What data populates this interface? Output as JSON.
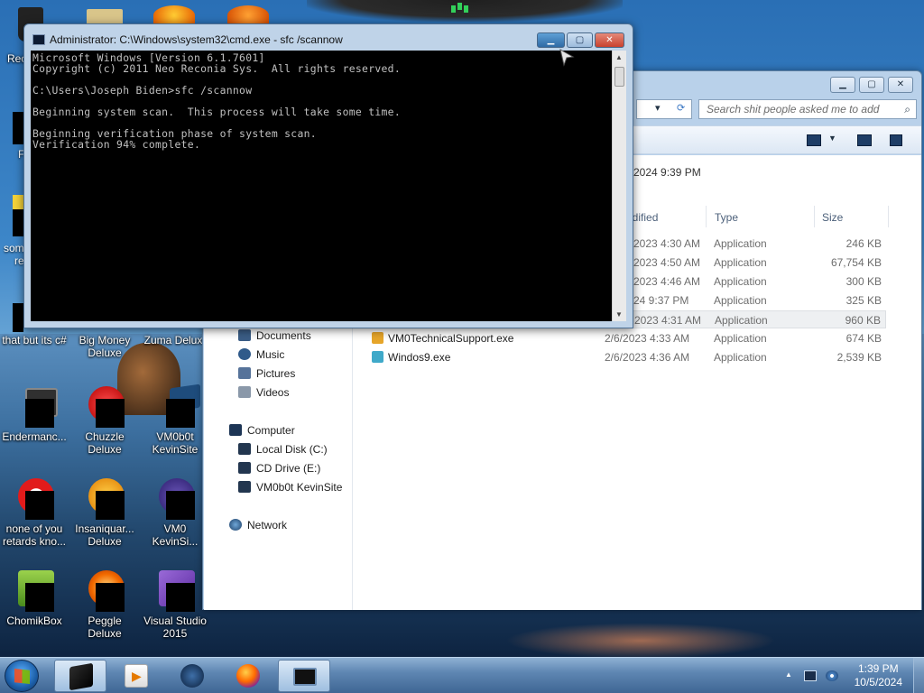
{
  "desktop": {
    "icons": [
      {
        "label": "Rec",
        "pos": "r0c0"
      },
      {
        "label": "that but its c#",
        "pos": "r1c0"
      },
      {
        "label": "Big Money Deluxe",
        "pos": "r1c1"
      },
      {
        "label": "Zuma Delux",
        "pos": "r1c2"
      },
      {
        "label": "Endermanc...",
        "pos": "r2c0"
      },
      {
        "label": "Chuzzle Deluxe",
        "pos": "r2c1"
      },
      {
        "label": "VM0b0t KevinSite",
        "pos": "r2c2"
      },
      {
        "label": "none of you retards kno...",
        "pos": "r3c0"
      },
      {
        "label": "Insaniquar... Deluxe",
        "pos": "r3c1"
      },
      {
        "label": "VM0 KevinSi...",
        "pos": "r3c2"
      },
      {
        "label": "ChomikBox",
        "pos": "r4c0"
      },
      {
        "label": "Peggle Deluxe",
        "pos": "r4c1"
      },
      {
        "label": "Visual Studio 2015",
        "pos": "r4c2"
      }
    ],
    "partial_labels": [
      "F",
      "som",
      "re"
    ]
  },
  "cmd": {
    "title": "Administrator: C:\\Windows\\system32\\cmd.exe - sfc  /scannow",
    "lines": [
      "Microsoft Windows [Version 6.1.7601]",
      "Copyright (c) 2011 Neo Reconia Sys.  All rights reserved.",
      "",
      "C:\\Users\\Joseph Biden>sfc /scannow",
      "",
      "Beginning system scan.  This process will take some time.",
      "",
      "Beginning verification phase of system scan.",
      "Verification 94% complete."
    ],
    "btn_min": "▁",
    "btn_max": "▢",
    "btn_close": "✕"
  },
  "explorer": {
    "search_placeholder": "Search shit people asked me to add",
    "info_text": "1/2024 9:39 PM",
    "columns": {
      "modified": "odified",
      "type": "Type",
      "size": "Size"
    },
    "nav": [
      {
        "label": "Documents",
        "icon": "documents-icon"
      },
      {
        "label": "Music",
        "icon": "music-icon"
      },
      {
        "label": "Pictures",
        "icon": "pictures-icon"
      },
      {
        "label": "Videos",
        "icon": "videos-icon"
      },
      {
        "label": "Computer",
        "icon": "computer-icon"
      },
      {
        "label": "Local Disk (C:)",
        "icon": "disk-icon"
      },
      {
        "label": "CD Drive (E:)",
        "icon": "cd-drive-icon"
      },
      {
        "label": "VM0b0t KevinSite",
        "icon": "network-drive-icon"
      },
      {
        "label": "Network",
        "icon": "network-icon"
      }
    ],
    "files": [
      {
        "name": "",
        "date": "2023 4:30 AM",
        "type": "Application",
        "size": "246 KB"
      },
      {
        "name": "",
        "date": "2023 4:50 AM",
        "type": "Application",
        "size": "67,754 KB"
      },
      {
        "name": "",
        "date": "2023 4:46 AM",
        "type": "Application",
        "size": "300 KB"
      },
      {
        "name": "",
        "date": "24 9:37 PM",
        "type": "Application",
        "size": "325 KB"
      },
      {
        "name": "",
        "date": "2023 4:31 AM",
        "type": "Application",
        "size": "960 KB"
      },
      {
        "name": "VM0TechnicalSupport.exe",
        "date": "2/6/2023 4:33 AM",
        "type": "Application",
        "size": "674 KB"
      },
      {
        "name": "Windos9.exe",
        "date": "2/6/2023 4:36 AM",
        "type": "Application",
        "size": "2,539 KB"
      }
    ]
  },
  "taskbar": {
    "time": "1:39 PM",
    "date": "10/5/2024",
    "tray_arrow": "▲"
  },
  "colors": {
    "accent": "#3f6694",
    "cmd_bg": "#000000",
    "cmd_text": "#c0c0c0",
    "close_red": "#c8412f"
  }
}
